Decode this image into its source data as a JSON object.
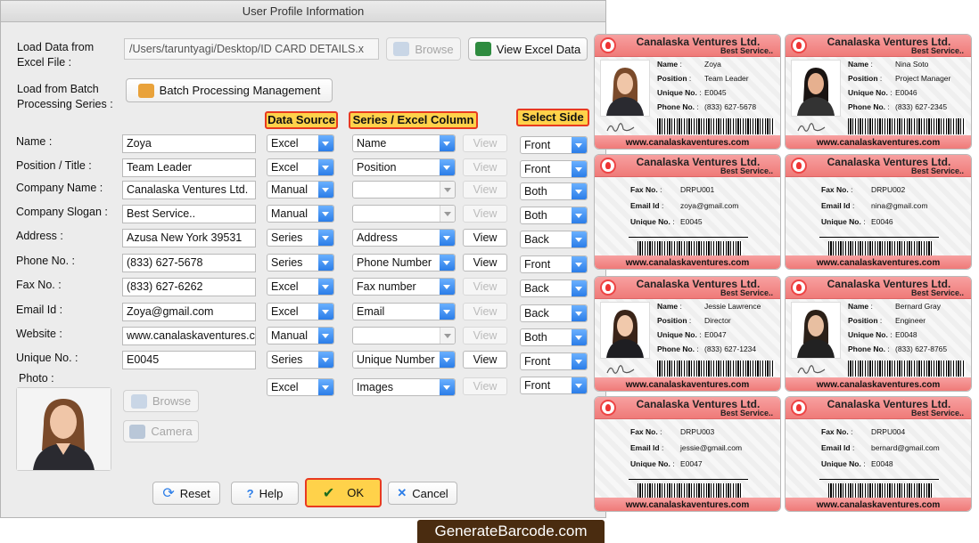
{
  "window": {
    "title": "User Profile Information"
  },
  "load": {
    "excel_label": "Load Data from Excel File :",
    "path": "/Users/taruntyagi/Desktop/ID CARD DETAILS.x",
    "browse": "Browse",
    "view_excel": "View Excel Data",
    "batch_label": "Load from Batch Processing Series :",
    "batch_button": "Batch Processing Management"
  },
  "headers": {
    "data_source": "Data Source",
    "series_col": "Series / Excel Column",
    "select_side": "Select Side"
  },
  "rows": [
    {
      "label": "Name :",
      "value": "Zoya",
      "source": "Excel",
      "column": "Name",
      "view": "View",
      "view_enabled": false,
      "side": "Front"
    },
    {
      "label": "Position / Title :",
      "value": "Team Leader",
      "source": "Excel",
      "column": "Position",
      "view": "View",
      "view_enabled": false,
      "side": "Front"
    },
    {
      "label": "Company Name :",
      "value": "Canalaska Ventures Ltd.",
      "source": "Manual",
      "column": "",
      "view": "View",
      "view_enabled": false,
      "side": "Both"
    },
    {
      "label": "Company Slogan :",
      "value": "Best Service..",
      "source": "Manual",
      "column": "",
      "view": "View",
      "view_enabled": false,
      "side": "Both"
    },
    {
      "label": "Address :",
      "value": "Azusa New York 39531",
      "source": "Series",
      "column": "Address",
      "view": "View",
      "view_enabled": true,
      "side": "Back"
    },
    {
      "label": "Phone No. :",
      "value": "(833) 627-5678",
      "source": "Series",
      "column": "Phone Number",
      "view": "View",
      "view_enabled": true,
      "side": "Front"
    },
    {
      "label": "Fax No. :",
      "value": "(833) 627-6262",
      "source": "Excel",
      "column": "Fax number",
      "view": "View",
      "view_enabled": false,
      "side": "Back"
    },
    {
      "label": "Email Id :",
      "value": "Zoya@gmail.com",
      "source": "Excel",
      "column": "Email",
      "view": "View",
      "view_enabled": false,
      "side": "Back"
    },
    {
      "label": "Website :",
      "value": "www.canalaskaventures.c",
      "source": "Manual",
      "column": "",
      "view": "View",
      "view_enabled": false,
      "side": "Both"
    },
    {
      "label": "Unique No. :",
      "value": "E0045",
      "source": "Series",
      "column": "Unique Number",
      "view": "View",
      "view_enabled": true,
      "side": "Front"
    }
  ],
  "photo": {
    "label": "Photo :",
    "source": "Excel",
    "column": "Images",
    "view": "View",
    "side": "Front",
    "browse": "Browse",
    "camera": "Camera"
  },
  "actions": {
    "reset": "Reset",
    "help": "Help",
    "ok": "OK",
    "cancel": "Cancel"
  },
  "cards": {
    "company": "Canalaska Ventures Ltd.",
    "slogan": "Best Service..",
    "website": "www.canalaskaventures.com",
    "labels": {
      "name": "Name",
      "position": "Position",
      "unique": "Unique No.",
      "phone": "Phone No.",
      "fax": "Fax No.",
      "email": "Email Id"
    },
    "fronts": [
      {
        "name": "Zoya",
        "position": "Team Leader",
        "unique": "E0045",
        "phone": "(833) 627-5678"
      },
      {
        "name": "Nina Soto",
        "position": "Project Manager",
        "unique": "E0046",
        "phone": "(833) 627-2345"
      },
      {
        "name": "Jessie Lawrence",
        "position": "Director",
        "unique": "E0047",
        "phone": "(833) 627-1234"
      },
      {
        "name": "Bernard Gray",
        "position": "Engineer",
        "unique": "E0048",
        "phone": "(833) 627-8765"
      }
    ],
    "backs": [
      {
        "fax": "DRPU001",
        "email": "zoya@gmail.com",
        "unique": "E0045"
      },
      {
        "fax": "DRPU002",
        "email": "nina@gmail.com",
        "unique": "E0046"
      },
      {
        "fax": "DRPU003",
        "email": "jessie@gmail.com",
        "unique": "E0047"
      },
      {
        "fax": "DRPU004",
        "email": "bernard@gmail.com",
        "unique": "E0048"
      }
    ]
  },
  "badge": "GenerateBarcode.com",
  "colors": {
    "accent_blue": "#2b7de8",
    "header_yellow": "#ffd24a",
    "header_border": "#e83a20",
    "card_red": "#ef7a78"
  }
}
